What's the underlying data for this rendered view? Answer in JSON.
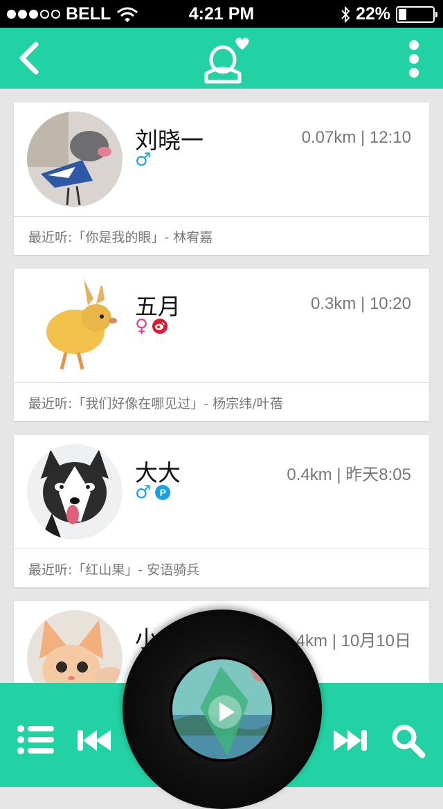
{
  "status_bar": {
    "carrier": "BELL",
    "time": "4:21 PM",
    "battery_percent_text": "22%",
    "battery_level": 0.22
  },
  "nav": {
    "back_icon": "chevron-left-icon",
    "logo_icon": "user-heart-icon",
    "more_icon": "vertical-ellipsis-icon"
  },
  "users": [
    {
      "name": "刘晓一",
      "meta": "0.07km | 12:10",
      "gender": "male",
      "gender_symbol": "♂",
      "extra_badge": null,
      "recent": "最近听:「你是我的眼」- 林宥嘉",
      "avatar": "bird-dog-avatar"
    },
    {
      "name": "五月",
      "meta": "0.3km | 10:20",
      "gender": "female",
      "gender_symbol": "♀",
      "extra_badge": "weibo",
      "recent": "最近听:「我们好像在哪见过」- 杨宗纬/叶蓓",
      "avatar": "bunny-duck-avatar"
    },
    {
      "name": "大大",
      "meta": "0.4km | 昨天8:05",
      "gender": "male",
      "gender_symbol": "♂",
      "extra_badge": "p",
      "recent": "最近听:「红山果」- 安语骑兵",
      "avatar": "husky-avatar"
    },
    {
      "name": "小",
      "meta": "4km | 10月10日",
      "gender": "female",
      "gender_symbol": "♀",
      "extra_badge": null,
      "recent": "",
      "avatar": "kitten-avatar"
    }
  ],
  "colors": {
    "accent": "#22d2a5",
    "male": "#1aa7e0",
    "female": "#e0409a",
    "weibo": "#e6162d",
    "p_badge": "#1a9ee6"
  },
  "bottom_bar": {
    "playlist_icon": "playlist-icon",
    "prev_icon": "previous-track-icon",
    "next_icon": "next-track-icon",
    "search_icon": "search-icon",
    "play_icon": "play-icon"
  }
}
